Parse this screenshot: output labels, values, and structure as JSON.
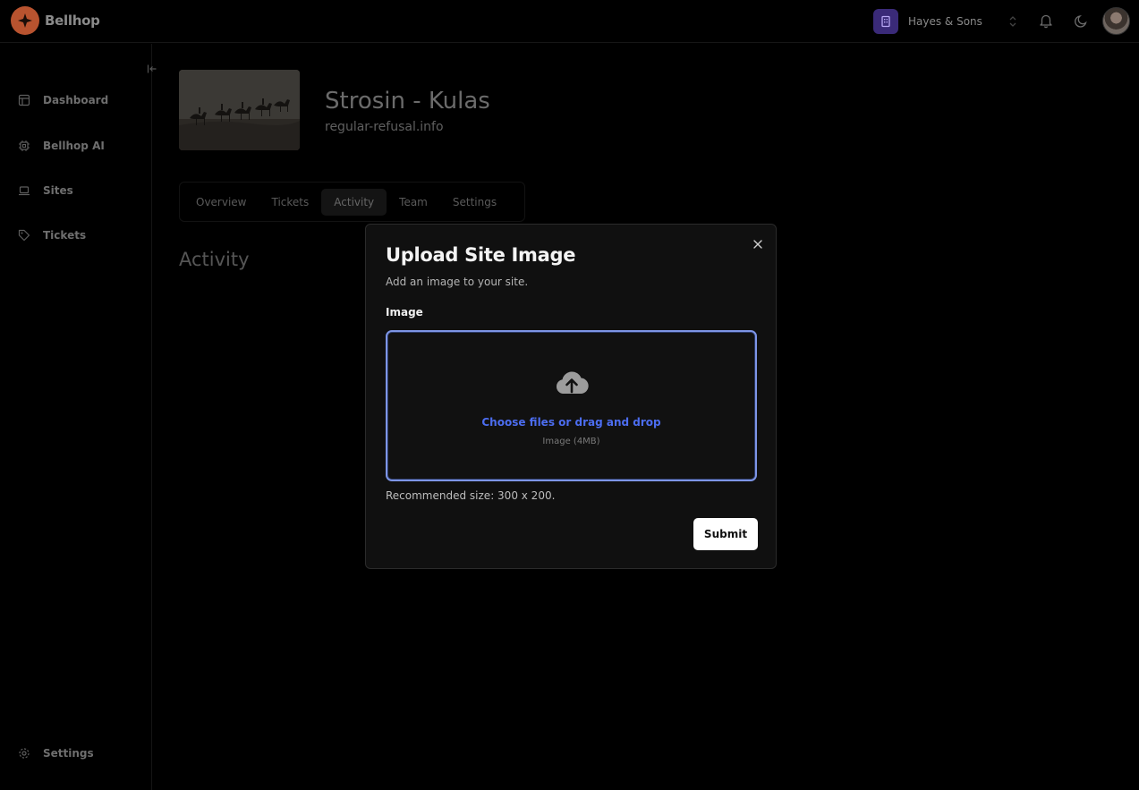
{
  "brand": {
    "name": "Bellhop"
  },
  "header": {
    "org_name": "Hayes & Sons"
  },
  "sidebar": {
    "items": [
      {
        "label": "Dashboard",
        "icon": "dashboard-icon"
      },
      {
        "label": "Bellhop AI",
        "icon": "chip-icon"
      },
      {
        "label": "Sites",
        "icon": "laptop-icon"
      },
      {
        "label": "Tickets",
        "icon": "tag-icon"
      }
    ],
    "footer_item": {
      "label": "Settings",
      "icon": "gear-icon"
    }
  },
  "site": {
    "title": "Strosin - Kulas",
    "url": "regular-refusal.info"
  },
  "tabs": [
    {
      "label": "Overview",
      "active": false
    },
    {
      "label": "Tickets",
      "active": false
    },
    {
      "label": "Activity",
      "active": true
    },
    {
      "label": "Team",
      "active": false
    },
    {
      "label": "Settings",
      "active": false
    }
  ],
  "section": {
    "heading": "Activity"
  },
  "modal": {
    "title": "Upload Site Image",
    "description": "Add an image to your site.",
    "field_label": "Image",
    "dropzone_cta": "Choose files or drag and drop",
    "dropzone_sub": "Image (4MB)",
    "hint": "Recommended size: 300 x 200.",
    "submit_label": "Submit"
  },
  "colors": {
    "accent": "#4c6df0",
    "dropzone_border": "#7d95e6",
    "brand": "#b8532f"
  }
}
